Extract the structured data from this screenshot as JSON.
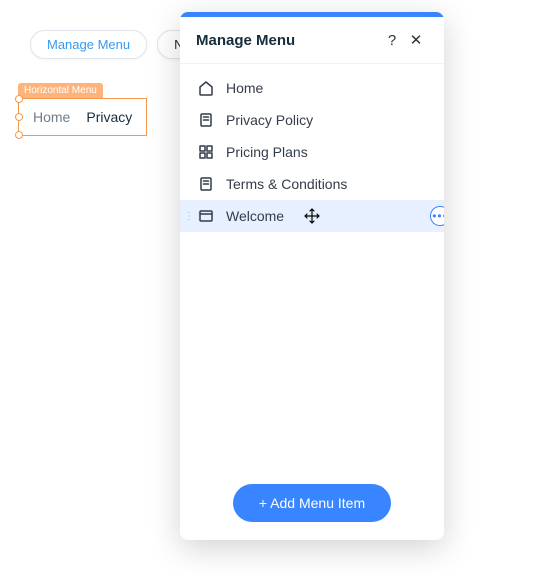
{
  "pills": {
    "manage": "Manage Menu",
    "navigate": "Na"
  },
  "selection": {
    "label": "Horizontal Menu",
    "items": [
      "Home",
      "Privacy"
    ]
  },
  "panel": {
    "title": "Manage Menu",
    "help_tooltip": "?",
    "close_tooltip": "✕",
    "add_button": "+ Add Menu Item"
  },
  "menu_items": [
    {
      "label": "Home",
      "icon": "home"
    },
    {
      "label": "Privacy Policy",
      "icon": "page"
    },
    {
      "label": "Pricing Plans",
      "icon": "grid"
    },
    {
      "label": "Terms & Conditions",
      "icon": "page"
    },
    {
      "label": "Welcome",
      "icon": "window",
      "selected": true
    }
  ]
}
